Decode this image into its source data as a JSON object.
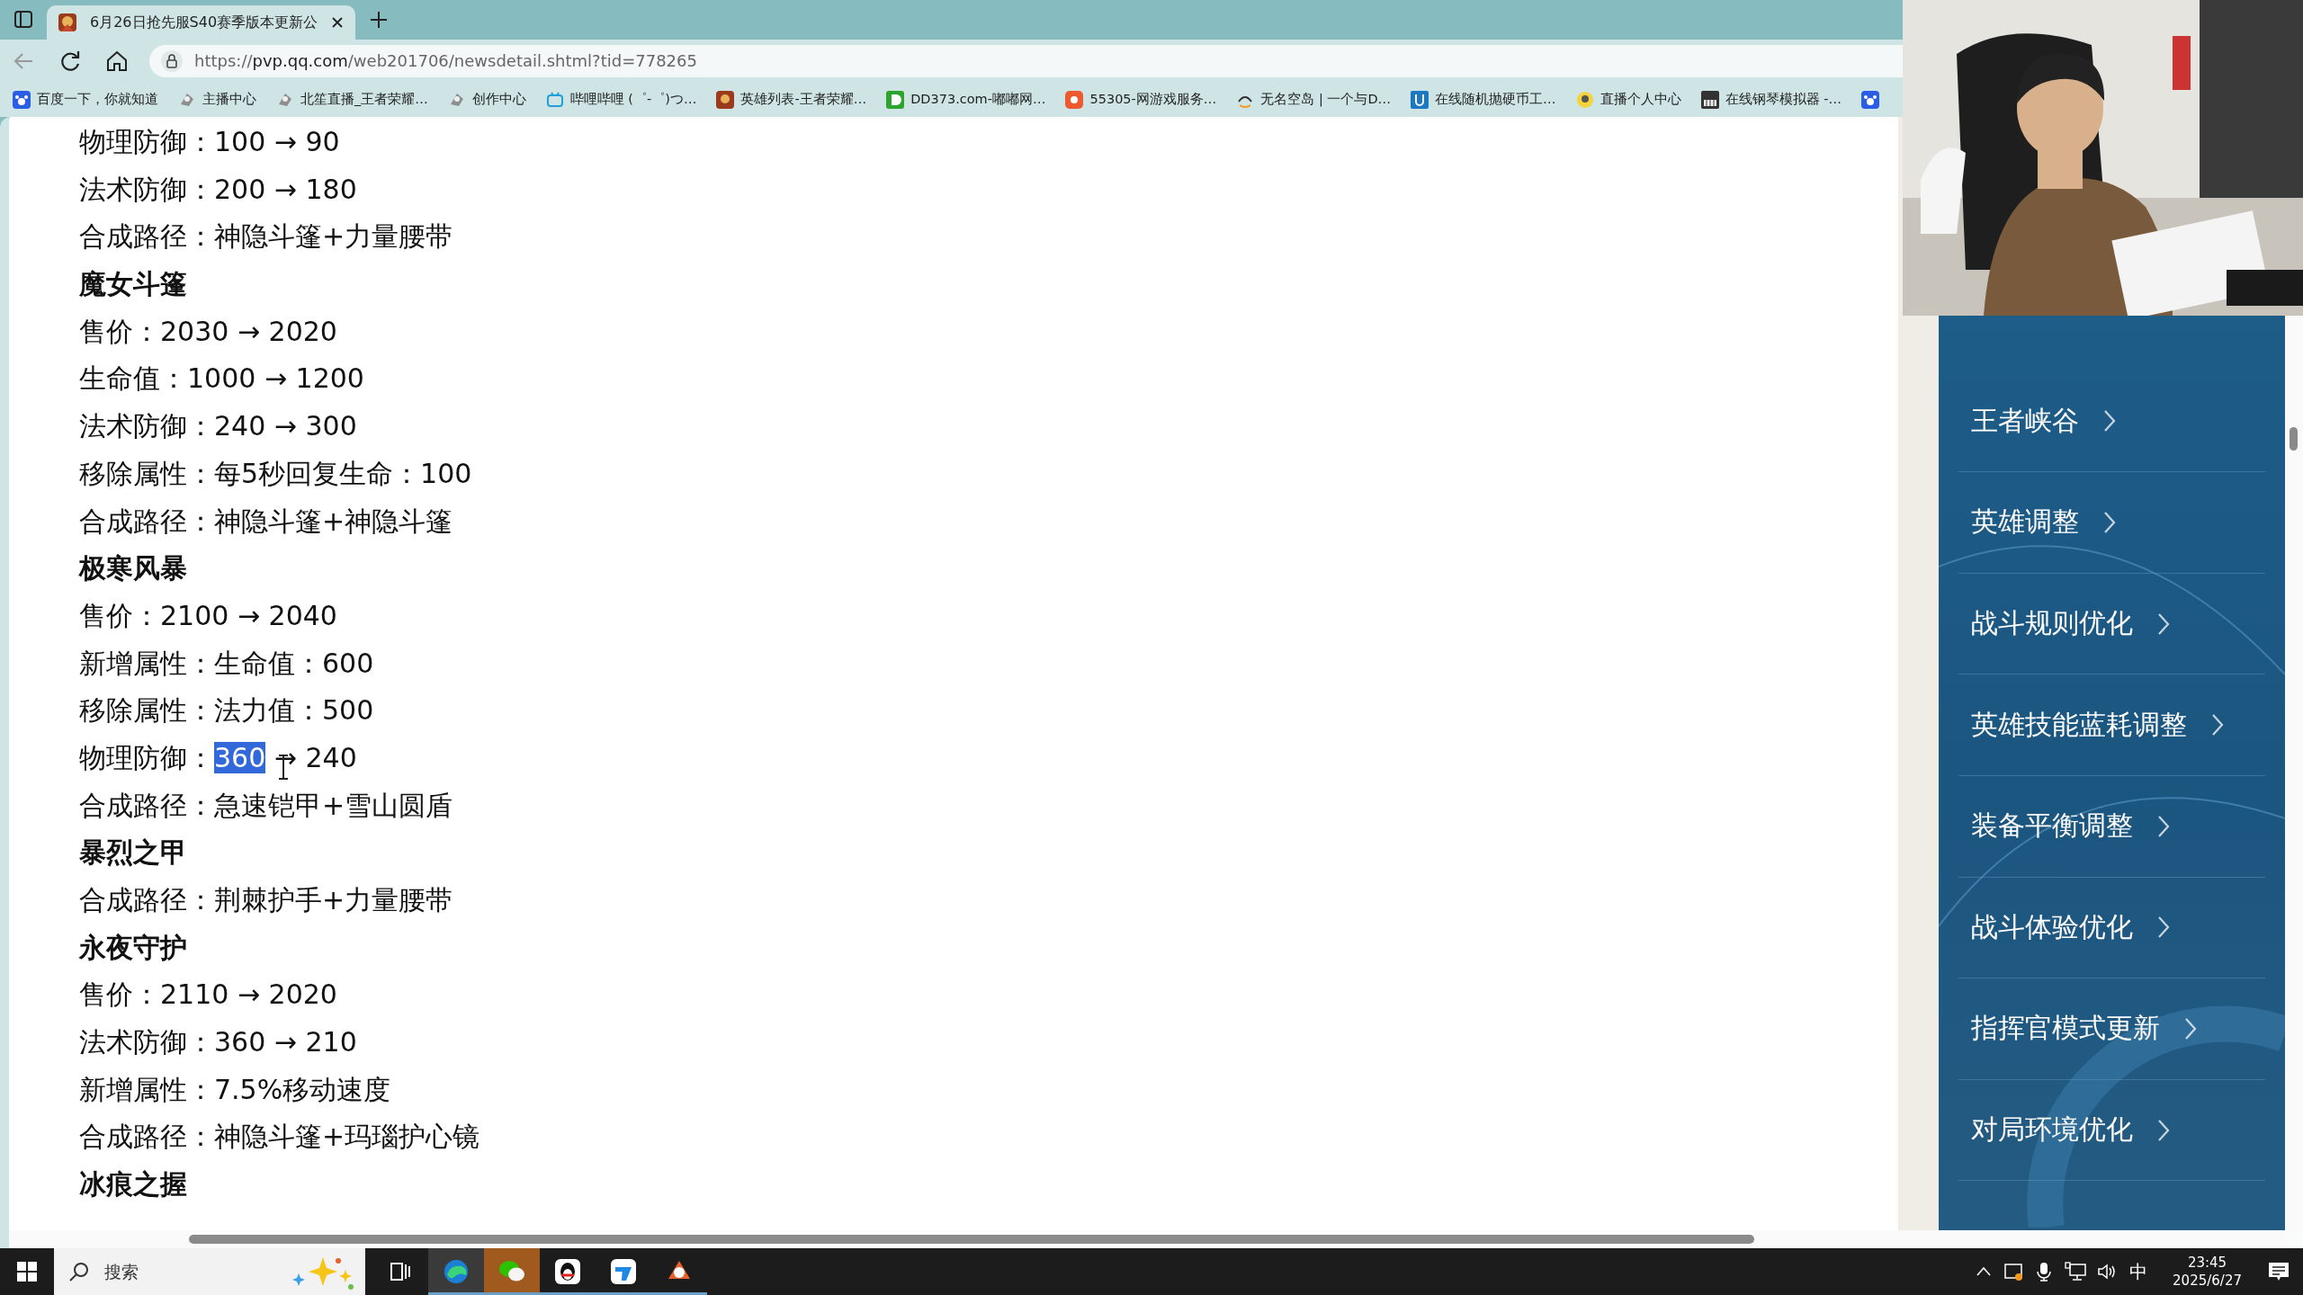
{
  "browser": {
    "tabs": [
      {
        "title": "6月26日抢先服S40赛季版本更新公",
        "selected": true
      }
    ],
    "url": {
      "scheme": "https://",
      "host": "pvp.qq.com",
      "path": "/web201706/newsdetail.shtml?tid=778265"
    },
    "bookmarks": [
      {
        "label": "百度一下，你就知道"
      },
      {
        "label": "主播中心"
      },
      {
        "label": "北笙直播_王者荣耀…"
      },
      {
        "label": "创作中心"
      },
      {
        "label": "哔哩哔哩 (゜-゜)つ…"
      },
      {
        "label": "英雄列表-王者荣耀…"
      },
      {
        "label": "DD373.com-嘟嘟网…"
      },
      {
        "label": "55305-网游戏服务…"
      },
      {
        "label": "无名空岛 | 一个与D…"
      },
      {
        "label": "在线随机抛硬币工…"
      },
      {
        "label": "直播个人中心"
      },
      {
        "label": "在线钢琴模拟器 -…"
      }
    ]
  },
  "article": {
    "lines": [
      {
        "kind": "change",
        "label": "物理防御：",
        "from": "100",
        "arrow": "→",
        "to": "90",
        "from_selected": false
      },
      {
        "kind": "change",
        "label": "法术防御：",
        "from": "200",
        "arrow": "→",
        "to": "180",
        "from_selected": false
      },
      {
        "kind": "plain",
        "label": "合成路径：",
        "text": "神隐斗篷+力量腰带"
      },
      {
        "kind": "heading",
        "text": "魔女斗篷"
      },
      {
        "kind": "change",
        "label": "售价：",
        "from": "2030",
        "arrow": "→",
        "to": "2020",
        "from_selected": false
      },
      {
        "kind": "change",
        "label": "生命值：",
        "from": "1000",
        "arrow": "→",
        "to": "1200",
        "from_selected": false
      },
      {
        "kind": "change",
        "label": "法术防御：",
        "from": "240",
        "arrow": "→",
        "to": "300",
        "from_selected": false
      },
      {
        "kind": "plain",
        "label": "移除属性：",
        "text": "每5秒回复生命：100"
      },
      {
        "kind": "plain",
        "label": "合成路径：",
        "text": "神隐斗篷+神隐斗篷"
      },
      {
        "kind": "heading",
        "text": "极寒风暴"
      },
      {
        "kind": "change",
        "label": "售价：",
        "from": "2100",
        "arrow": "→",
        "to": "2040",
        "from_selected": false
      },
      {
        "kind": "plain",
        "label": "新增属性：",
        "text": "生命值：600"
      },
      {
        "kind": "plain",
        "label": "移除属性：",
        "text": "法力值：500"
      },
      {
        "kind": "change",
        "label": "物理防御：",
        "from": "360",
        "arrow": "→",
        "to": "240",
        "from_selected": true
      },
      {
        "kind": "plain",
        "label": "合成路径：",
        "text": "急速铠甲+雪山圆盾"
      },
      {
        "kind": "heading",
        "text": "暴烈之甲"
      },
      {
        "kind": "plain",
        "label": "合成路径：",
        "text": "荆棘护手+力量腰带"
      },
      {
        "kind": "heading",
        "text": "永夜守护"
      },
      {
        "kind": "change",
        "label": "售价：",
        "from": "2110",
        "arrow": "→",
        "to": "2020",
        "from_selected": false
      },
      {
        "kind": "change",
        "label": "法术防御：",
        "from": "360",
        "arrow": "→",
        "to": "210",
        "from_selected": false
      },
      {
        "kind": "plain",
        "label": "新增属性：",
        "text": "7.5%移动速度"
      },
      {
        "kind": "plain",
        "label": "合成路径：",
        "text": "神隐斗篷+玛瑙护心镜"
      },
      {
        "kind": "heading",
        "text": "冰痕之握"
      }
    ]
  },
  "sidebar": {
    "items": [
      {
        "label": "王者峡谷"
      },
      {
        "label": "英雄调整"
      },
      {
        "label": "战斗规则优化"
      },
      {
        "label": "英雄技能蓝耗调整"
      },
      {
        "label": "装备平衡调整"
      },
      {
        "label": "战斗体验优化"
      },
      {
        "label": "指挥官模式更新"
      },
      {
        "label": "对局环境优化"
      }
    ]
  },
  "taskbar": {
    "search": {
      "placeholder": "搜索"
    },
    "apps": [
      {
        "running": false,
        "active": false,
        "flashing": false
      },
      {
        "running": true,
        "active": true,
        "flashing": false
      },
      {
        "running": true,
        "active": false,
        "flashing": true
      },
      {
        "running": true,
        "active": false,
        "flashing": false
      },
      {
        "running": true,
        "active": false,
        "flashing": false
      },
      {
        "running": true,
        "active": false,
        "flashing": false
      }
    ],
    "tray": {
      "ime": "中",
      "time": "23:45",
      "date": "2025/6/27"
    }
  }
}
